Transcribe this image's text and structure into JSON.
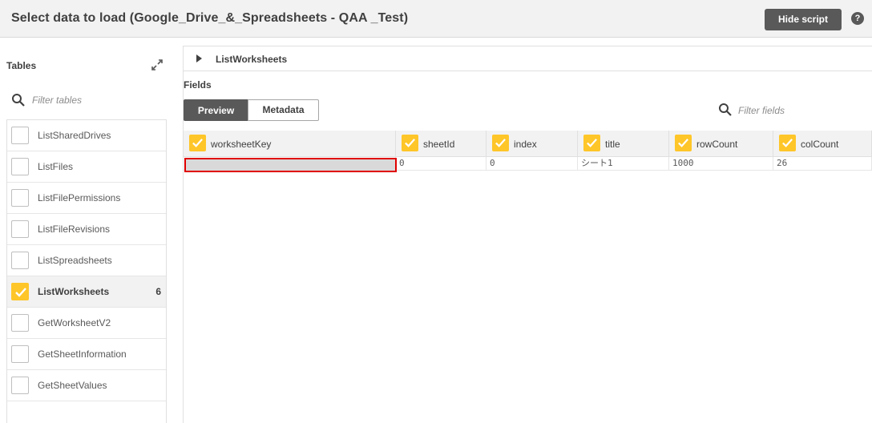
{
  "header": {
    "title": "Select data to load (Google_Drive_&_Spreadsheets - QAA _Test)",
    "hide_script_label": "Hide script",
    "help_label": "?"
  },
  "tables_panel": {
    "label": "Tables",
    "filter_placeholder": "Filter tables",
    "items": [
      {
        "label": "ListSharedDrives",
        "checked": false,
        "count": ""
      },
      {
        "label": "ListFiles",
        "checked": false,
        "count": ""
      },
      {
        "label": "ListFilePermissions",
        "checked": false,
        "count": ""
      },
      {
        "label": "ListFileRevisions",
        "checked": false,
        "count": ""
      },
      {
        "label": "ListSpreadsheets",
        "checked": false,
        "count": ""
      },
      {
        "label": "ListWorksheets",
        "checked": true,
        "count": "6"
      },
      {
        "label": "GetWorksheetV2",
        "checked": false,
        "count": ""
      },
      {
        "label": "GetSheetInformation",
        "checked": false,
        "count": ""
      },
      {
        "label": "GetSheetValues",
        "checked": false,
        "count": ""
      }
    ]
  },
  "selected_table": {
    "name": "ListWorksheets"
  },
  "fields": {
    "label": "Fields",
    "tabs": [
      {
        "label": "Preview",
        "active": true
      },
      {
        "label": "Metadata",
        "active": false
      }
    ],
    "filter_placeholder": "Filter fields"
  },
  "grid": {
    "columns": [
      "worksheetKey",
      "sheetId",
      "index",
      "title",
      "rowCount",
      "colCount"
    ],
    "rows": [
      [
        "",
        "0",
        "0",
        "シート1",
        "1000",
        "26"
      ]
    ]
  },
  "colors": {
    "accent": "#ffc629",
    "dark_button": "#595959",
    "highlight_border": "#e00000"
  }
}
